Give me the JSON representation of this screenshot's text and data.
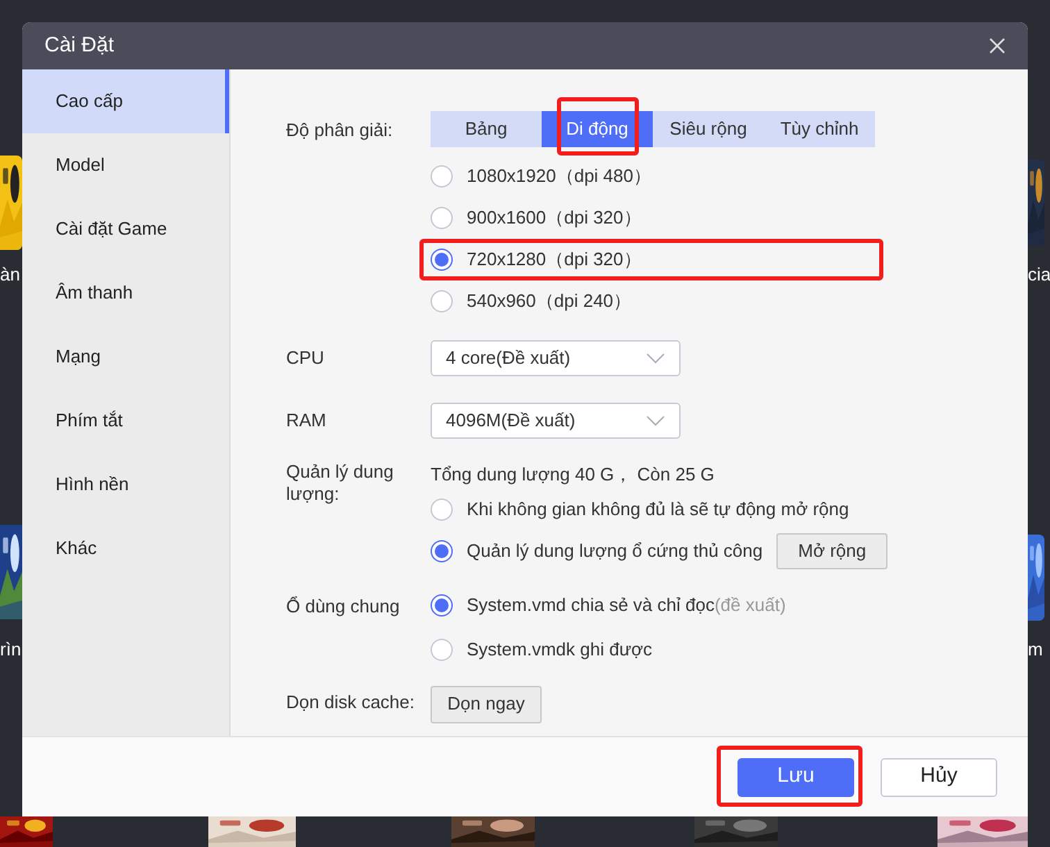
{
  "background": {
    "left_labels": [
      "àn",
      "rìn"
    ],
    "right_labels": [
      "cia",
      "m"
    ]
  },
  "dialog": {
    "title": "Cài Đặt",
    "sidebar": {
      "items": [
        {
          "label": "Cao cấp",
          "selected": true
        },
        {
          "label": "Model",
          "selected": false
        },
        {
          "label": "Cài đặt Game",
          "selected": false
        },
        {
          "label": "Âm thanh",
          "selected": false
        },
        {
          "label": "Mạng",
          "selected": false
        },
        {
          "label": "Phím tắt",
          "selected": false
        },
        {
          "label": "Hình nền",
          "selected": false
        },
        {
          "label": "Khác",
          "selected": false
        }
      ]
    },
    "resolution": {
      "label": "Độ phân giải:",
      "tabs": [
        {
          "label": "Bảng",
          "selected": false,
          "highlighted": false
        },
        {
          "label": "Di động",
          "selected": true,
          "highlighted": true
        },
        {
          "label": "Siêu rộng",
          "selected": false,
          "highlighted": false
        },
        {
          "label": "Tùy chỉnh",
          "selected": false,
          "highlighted": false
        }
      ],
      "options": [
        {
          "label": "1080x1920（dpi 480）",
          "selected": false,
          "highlighted": false
        },
        {
          "label": "900x1600（dpi 320）",
          "selected": false,
          "highlighted": false
        },
        {
          "label": "720x1280（dpi 320）",
          "selected": true,
          "highlighted": true
        },
        {
          "label": "540x960（dpi 240）",
          "selected": false,
          "highlighted": false
        }
      ]
    },
    "cpu": {
      "label": "CPU",
      "value": "4 core(Đề xuất)"
    },
    "ram": {
      "label": "RAM",
      "value": "4096M(Đề xuất)"
    },
    "storage": {
      "label": "Quản lý dung lượng:",
      "summary": "Tổng dung lượng 40 G， Còn  25 G",
      "options": [
        {
          "label": "Khi không gian không đủ là sẽ tự động mở rộng",
          "selected": false
        },
        {
          "label": "Quản lý dung lượng ổ cứng thủ công",
          "selected": true,
          "button": "Mở rộng"
        }
      ]
    },
    "shared_disk": {
      "label": "Ổ dùng chung",
      "options": [
        {
          "label": "System.vmd chia sẻ và chỉ đọc",
          "note": "(đề xuất)",
          "selected": true
        },
        {
          "label": "System.vmdk ghi được",
          "selected": false
        }
      ]
    },
    "cache": {
      "label": "Dọn disk cache:",
      "button": "Dọn ngay"
    },
    "buttons": [
      {
        "label": "Lưu",
        "kind": "primary",
        "highlighted": true
      },
      {
        "label": "Hủy",
        "kind": "secondary",
        "highlighted": false
      }
    ]
  }
}
